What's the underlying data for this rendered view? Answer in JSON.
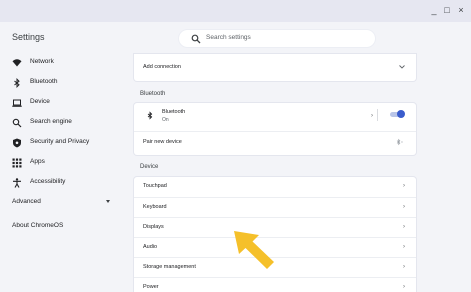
{
  "window": {
    "controls": {
      "minimize": "_",
      "maximize": "□",
      "close": "×"
    }
  },
  "header": {
    "title": "Settings",
    "search_placeholder": "Search settings"
  },
  "sidebar": {
    "items": [
      {
        "label": "Network",
        "icon": "wifi-icon"
      },
      {
        "label": "Bluetooth",
        "icon": "bluetooth-icon"
      },
      {
        "label": "Device",
        "icon": "laptop-icon"
      },
      {
        "label": "Search engine",
        "icon": "search-icon"
      },
      {
        "label": "Security and Privacy",
        "icon": "shield-icon"
      },
      {
        "label": "Apps",
        "icon": "apps-grid-icon"
      },
      {
        "label": "Accessibility",
        "icon": "accessibility-icon"
      }
    ],
    "advanced_label": "Advanced",
    "about_label": "About ChromeOS"
  },
  "main": {
    "network_card": {
      "add_connection": "Add connection"
    },
    "bluetooth_section": {
      "title": "Bluetooth",
      "name": "Bluetooth",
      "status": "On",
      "toggle_on": true,
      "pair_new_device": "Pair new device"
    },
    "device_section": {
      "title": "Device",
      "rows": [
        "Touchpad",
        "Keyboard",
        "Displays",
        "Audio",
        "Storage management",
        "Power"
      ]
    }
  },
  "colors": {
    "accent": "#3a5ccc",
    "cursor_arrow": "#f5c02a",
    "background": "#f3f4f8"
  }
}
